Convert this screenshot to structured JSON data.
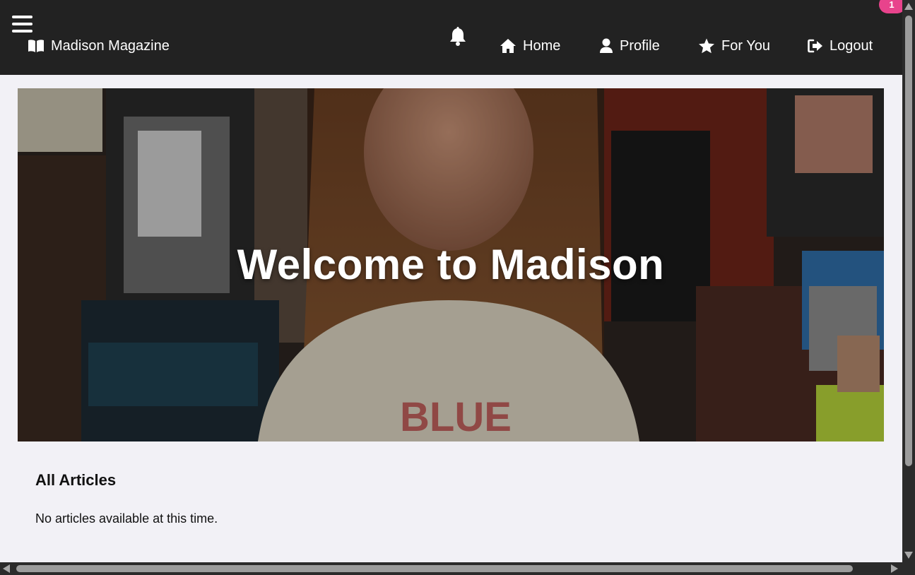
{
  "navbar": {
    "brand_label": "Madison Magazine",
    "notification_count": "1",
    "items": [
      {
        "label": "Home",
        "icon": "home-icon"
      },
      {
        "label": "Profile",
        "icon": "user-icon"
      },
      {
        "label": "For You",
        "icon": "star-icon"
      },
      {
        "label": "Logout",
        "icon": "logout-icon"
      }
    ]
  },
  "hero": {
    "title": "Welcome to Madison",
    "image": "hero-collage-image"
  },
  "articles": {
    "heading": "All Articles",
    "empty_message": "No articles available at this time."
  },
  "colors": {
    "navbar_bg": "#222222",
    "page_bg": "#f2f1f6",
    "badge_bg": "#e8438c",
    "text_light": "#ffffff"
  }
}
